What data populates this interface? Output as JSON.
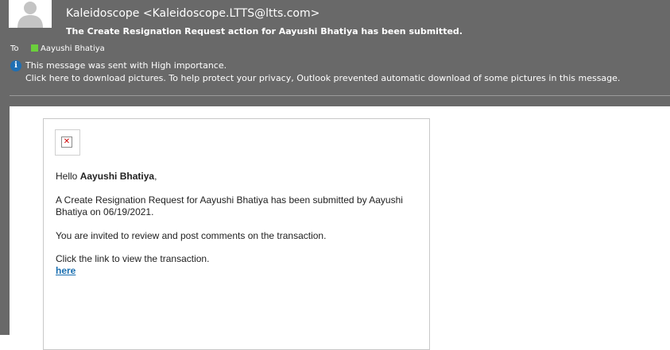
{
  "message": {
    "sender": "Kaleidoscope <Kaleidoscope.LTTS@ltts.com>",
    "subject": "The Create Resignation Request action for Aayushi Bhatiya has been submitted.",
    "to_label": "To",
    "recipient": "Aayushi Bhatiya",
    "importance_notice": "This message was sent with High importance.",
    "pictures_notice": "Click here to download pictures. To help protect your privacy, Outlook prevented automatic download of some pictures in this message."
  },
  "body": {
    "greeting_prefix": "Hello ",
    "greeting_name": "Aayushi Bhatiya",
    "greeting_suffix": ",",
    "paragraph1": "A Create Resignation Request for Aayushi Bhatiya has been submitted by Aayushi Bhatiya on 06/19/2021.",
    "paragraph2": "You are invited to review and post comments on the transaction.",
    "paragraph3": "Click the link to view the transaction.",
    "link_text": "here"
  },
  "icons": {
    "avatar": "person-silhouette",
    "info": "info-icon",
    "broken_image": "broken-image-icon"
  },
  "colors": {
    "header_bg": "#696969",
    "presence_available": "#6bcf3c",
    "info_blue": "#1f6fb3",
    "link": "#1a6fb0"
  }
}
